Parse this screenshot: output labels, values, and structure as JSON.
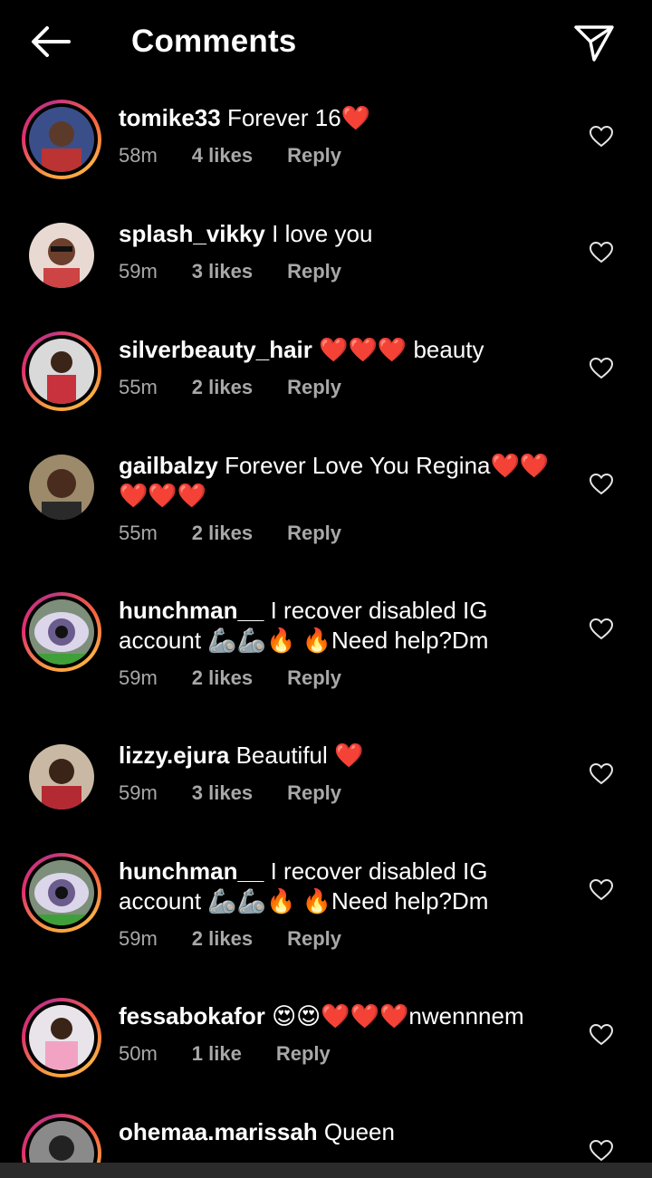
{
  "header": {
    "title": "Comments",
    "back_icon": "arrow-left-icon",
    "send_icon": "paper-plane-icon"
  },
  "colors": {
    "background": "#000000",
    "meta_text": "#a8a8a8",
    "story_ring": "#e1306c",
    "heart": "#e0142a"
  },
  "comments": [
    {
      "user": "tomike33",
      "text": "Forever 16❤️",
      "time": "58m",
      "likes": "4 likes",
      "reply": "Reply",
      "ring": true
    },
    {
      "user": "splash_vikky",
      "text": "I love you",
      "time": "59m",
      "likes": "3 likes",
      "reply": "Reply",
      "ring": false
    },
    {
      "user": "silverbeauty_hair",
      "text": "❤️❤️❤️ beauty",
      "time": "55m",
      "likes": "2 likes",
      "reply": "Reply",
      "ring": true
    },
    {
      "user": "gailbalzy",
      "text": "Forever Love You Regina❤️❤️❤️❤️❤️",
      "time": "55m",
      "likes": "2 likes",
      "reply": "Reply",
      "ring": false
    },
    {
      "user": "hunchman__",
      "text": "I recover disabled IG account 🦾🦾🔥 🔥Need help?Dm",
      "time": "59m",
      "likes": "2 likes",
      "reply": "Reply",
      "ring": true
    },
    {
      "user": "lizzy.ejura",
      "text": "Beautiful ❤️",
      "time": "59m",
      "likes": "3 likes",
      "reply": "Reply",
      "ring": false
    },
    {
      "user": "hunchman__",
      "text": "I recover disabled IG account 🦾🦾🔥 🔥Need help?Dm",
      "time": "59m",
      "likes": "2 likes",
      "reply": "Reply",
      "ring": true
    },
    {
      "user": "fessabokafor",
      "text": "😍😍❤️❤️❤️nwennnem",
      "time": "50m",
      "likes": "1 like",
      "reply": "Reply",
      "ring": true
    },
    {
      "user": "ohemaa.marissah",
      "text": "Queen",
      "time": "",
      "likes": "",
      "reply": "",
      "ring": true
    }
  ]
}
